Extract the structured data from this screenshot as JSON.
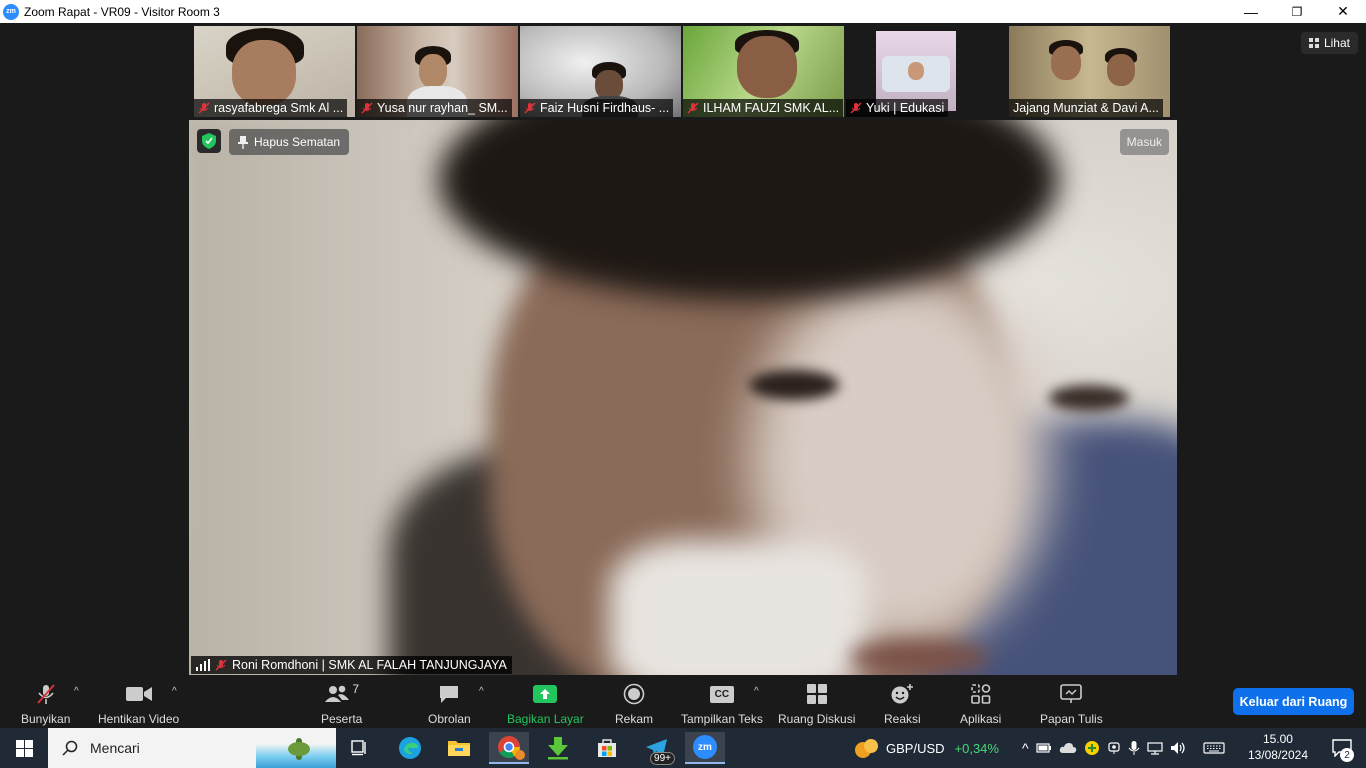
{
  "window": {
    "title": "Zoom Rapat - VR09 - Visitor Room 3",
    "logo_text": "zm",
    "controls": [
      "—",
      "❐",
      "✕"
    ]
  },
  "view_button": {
    "label": "Lihat"
  },
  "participants_strip": [
    {
      "name": "rasyafabrega Smk Al ...",
      "muted": true,
      "active": true
    },
    {
      "name": "Yusa nur rayhan_ SM...",
      "muted": true,
      "active": false
    },
    {
      "name": "Faiz Husni Firdhaus- ...",
      "muted": true,
      "active": false
    },
    {
      "name": "ILHAM FAUZI SMK AL...",
      "muted": true,
      "active": false
    },
    {
      "name": "Yuki | Edukasi",
      "muted": true,
      "active": false
    },
    {
      "name": "Jajang Munziat & Davi A...",
      "muted": false,
      "active": false
    }
  ],
  "main_video": {
    "unpin_label": "Hapus Sematan",
    "enter_label": "Masuk",
    "speaker_name": "Roni Romdhoni | SMK AL FALAH TANJUNGJAYA"
  },
  "toolbar": {
    "mute": "Bunyikan",
    "video": "Hentikan Video",
    "participants": "Peserta",
    "participants_count": "7",
    "chat": "Obrolan",
    "share": "Bagikan Layar",
    "record": "Rekam",
    "captions": "Tampilkan Teks",
    "captions_icon": "CC",
    "breakout": "Ruang Diskusi",
    "reactions": "Reaksi",
    "apps": "Aplikasi",
    "whiteboard": "Papan Tulis",
    "leave": "Keluar dari Ruang",
    "accent": "#0e71eb",
    "share_color": "#22c55e"
  },
  "taskbar": {
    "search_placeholder": "Mencari",
    "badge_count": "99+",
    "zoom_icon_text": "zm",
    "ticker_symbol": "GBP/USD",
    "ticker_change": "+0,34%",
    "time": "15.00",
    "date": "13/08/2024",
    "notifications": "2"
  }
}
